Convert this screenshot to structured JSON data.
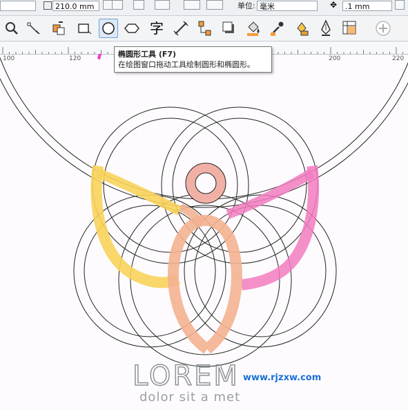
{
  "property_bar": {
    "height_value": "210.0 mm",
    "units_label": "单位:",
    "units_value": "毫米",
    "nudge_value": ".1 mm"
  },
  "toolbar": {
    "tools": [
      {
        "name": "zoom-tool",
        "icon": "magnifier-icon"
      },
      {
        "name": "shape-tool",
        "icon": "shape-node-icon"
      },
      {
        "name": "smart-fill-tool",
        "icon": "smart-fill-icon"
      },
      {
        "name": "rectangle-tool",
        "icon": "rectangle-icon"
      },
      {
        "name": "ellipse-tool",
        "icon": "ellipse-icon",
        "active": true
      },
      {
        "name": "polygon-tool",
        "icon": "polygon-icon"
      },
      {
        "name": "text-tool",
        "icon": "text-icon",
        "glyph": "字"
      },
      {
        "name": "dimension-tool",
        "icon": "dimension-icon"
      },
      {
        "name": "connector-tool",
        "icon": "connector-icon"
      },
      {
        "name": "drop-shadow-tool",
        "icon": "drop-shadow-icon"
      },
      {
        "name": "fill-tool",
        "icon": "paint-bucket-icon"
      },
      {
        "name": "eyedropper-tool",
        "icon": "eyedropper-icon"
      },
      {
        "name": "interactive-fill-tool",
        "icon": "interactive-fill-icon"
      },
      {
        "name": "pen-tool",
        "icon": "pen-nib-icon"
      },
      {
        "name": "mesh-fill-tool",
        "icon": "mesh-fill-icon"
      },
      {
        "name": "customize-tool",
        "icon": "plus-circle-icon"
      }
    ]
  },
  "ruler": {
    "labels": [
      "100",
      "120",
      "200",
      "220"
    ]
  },
  "tooltip": {
    "title": "椭圆形工具 (F7)",
    "description": "在绘图窗口拖动工具绘制圆形和椭圆形。"
  },
  "canvas": {
    "logo_text": "LOREM",
    "tagline": "dolor sit a met",
    "watermark": "www.rjzxw.com",
    "colors": {
      "yellow": "#f8d35a",
      "pink": "#f27bbf",
      "peach": "#f4b190",
      "ring": "#f1b0a5",
      "arrow": "#ec3bd6",
      "logo_gray": "#8f9394"
    }
  }
}
